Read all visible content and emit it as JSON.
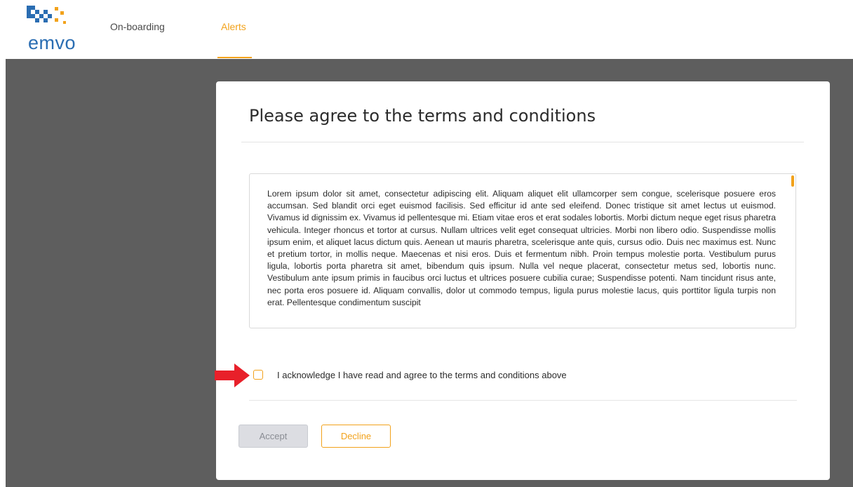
{
  "brand": {
    "logo_text": "emvo",
    "logo_colors": [
      "#2a6db2",
      "#f2a21b"
    ]
  },
  "nav": {
    "items": [
      {
        "label": "On-boarding",
        "active": false
      },
      {
        "label": "Alerts",
        "active": true
      }
    ]
  },
  "modal": {
    "title": "Please agree to the terms and conditions",
    "terms_text": "Lorem ipsum dolor sit amet, consectetur adipiscing elit. Aliquam aliquet elit ullamcorper sem congue, scelerisque posuere eros accumsan. Sed blandit orci eget euismod facilisis. Sed efficitur id ante sed eleifend. Donec tristique sit amet lectus ut euismod. Vivamus id dignissim ex. Vivamus id pellentesque mi. Etiam vitae eros et erat sodales lobortis. Morbi dictum neque eget risus pharetra vehicula. Integer rhoncus et tortor at cursus. Nullam ultrices velit eget consequat ultricies. Morbi non libero odio. Suspendisse mollis ipsum enim, et aliquet lacus dictum quis. Aenean ut mauris pharetra, scelerisque ante quis, cursus odio. Duis nec maximus est. Nunc et pretium tortor, in mollis neque. Maecenas et nisi eros. Duis et fermentum nibh. Proin tempus molestie porta. Vestibulum purus ligula, lobortis porta pharetra sit amet, bibendum quis ipsum. Nulla vel neque placerat, consectetur metus sed, lobortis nunc. Vestibulum ante ipsum primis in faucibus orci luctus et ultrices posuere cubilia curae; Suspendisse potenti. Nam tincidunt risus ante, nec porta eros posuere id. Aliquam convallis, dolor ut commodo tempus, ligula purus molestie lacus, quis porttitor ligula turpis non erat. Pellentesque condimentum suscipit",
    "acknowledge_label": "I acknowledge I have read and agree to the terms and conditions above",
    "acknowledge_checked": false,
    "accept_label": "Accept",
    "accept_disabled": true,
    "decline_label": "Decline"
  },
  "colors": {
    "accent": "#f2a21b",
    "backdrop": "#5e5e5e",
    "arrow": "#e8202a"
  },
  "icons": {
    "pointer": "red-arrow-icon",
    "logo": "emvo-logo-icon"
  }
}
